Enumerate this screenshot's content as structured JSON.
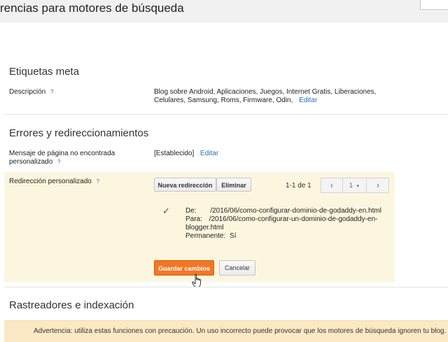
{
  "header": {
    "title": "rencias para motores de búsqueda"
  },
  "meta_tags": {
    "heading": "Etiquetas meta",
    "description_label": "Descripción",
    "help": "?",
    "description_line1": "Blog sobre Android, Aplicaciones, Juegos, Internet Gratis, Liberaciones,",
    "description_line2": "Celulares, Samsung, Roms, Firmware, Odin,",
    "edit_link": "Editar"
  },
  "errors": {
    "heading": "Errores y redireccionamientos",
    "not_found_label_line1": "Mensaje de página no encontrada",
    "not_found_label_line2": "personalizado",
    "not_found_value": "[Establecido]",
    "not_found_edit": "Editar",
    "redirect_label": "Redirección personalizado",
    "new_redirect_button": "Nueva redirección",
    "delete_button": "Eliminar",
    "pager_text": "1-1 de 1",
    "pager_prev": "‹",
    "pager_page": "1",
    "pager_next": "›",
    "redirect": {
      "from_label": "De:",
      "from_value": "/2016/06/como-configurar-dominio-de-godaddy-en.html",
      "to_label": "Para:",
      "to_value_line1": "/2016/06/como-configurar-un-dominio-de-godaddy-en-",
      "to_value_line2": "blogger.html",
      "permanent_label": "Permanente:",
      "permanent_value": "Sí"
    },
    "save_button": "Guardar cambios",
    "cancel_button": "Cancelar"
  },
  "crawlers": {
    "heading": "Rastreadores e indexación",
    "warning": "Advertencia: utiliza estas funciones con precaución. Un uso incorrecto puede provocar que los motores de búsqueda ignoren tu blog."
  },
  "colors": {
    "accent_orange": "#f27725",
    "highlight_bg": "#fdf6df",
    "link_blue": "#2a6fb3",
    "warning_bg": "#fbe9c5"
  }
}
